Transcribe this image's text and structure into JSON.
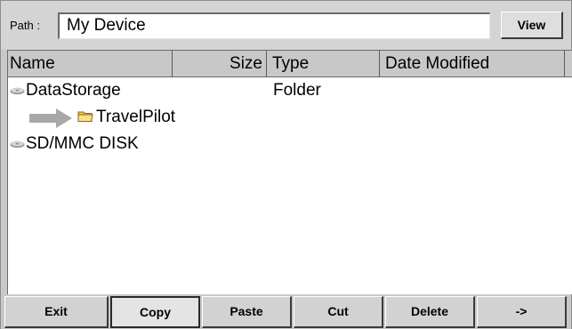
{
  "path": {
    "label": "Path :",
    "value": "My Device",
    "view_button": "View"
  },
  "list": {
    "columns": [
      "Name",
      "Size",
      "Type",
      "Date Modified"
    ],
    "rows": [
      {
        "name": "DataStorage",
        "size": "",
        "type": "Folder",
        "date": "",
        "icon": "disk-icon"
      },
      {
        "name": "TravelPilot",
        "size": "",
        "type": "",
        "date": "",
        "icon": "folder-icon",
        "indicator": "arrow-icon"
      },
      {
        "name": "SD/MMC DISK",
        "size": "",
        "type": "",
        "date": "",
        "icon": "disk-icon"
      }
    ]
  },
  "toolbar": {
    "buttons": [
      "Exit",
      "Copy",
      "Paste",
      "Cut",
      "Delete",
      "->"
    ],
    "active_button": "Copy"
  },
  "colors": {
    "window_bg": "#c8c8c8",
    "list_bg": "#ffffff",
    "folder_yellow": "#f2c64a",
    "arrow_gray": "#a8a8a8"
  }
}
